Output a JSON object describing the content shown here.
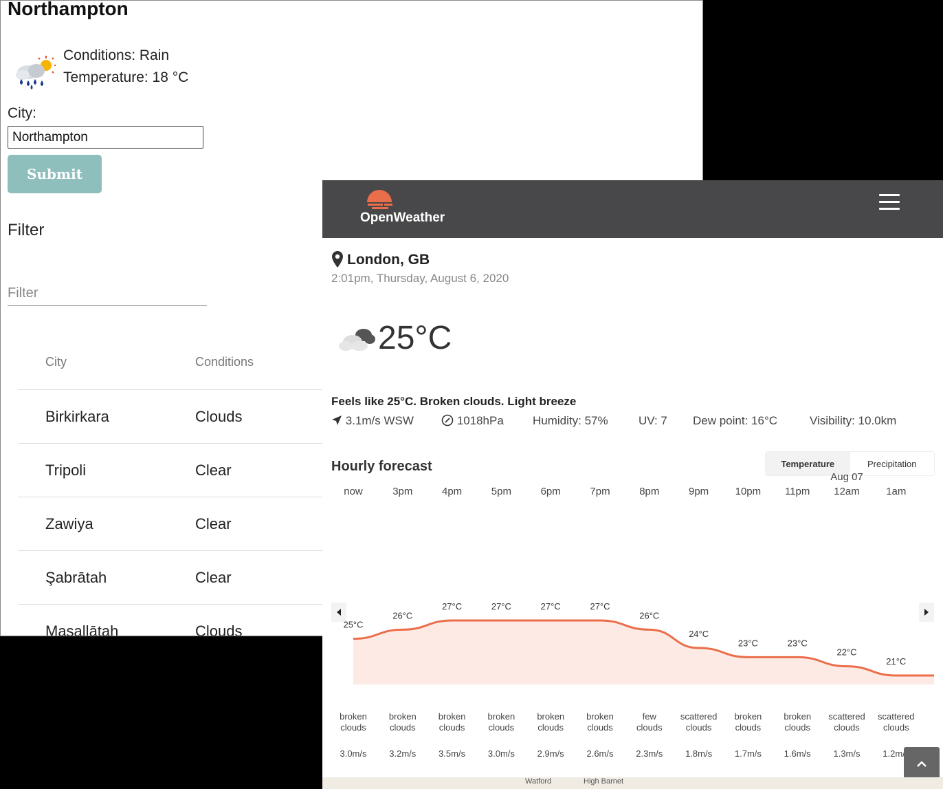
{
  "left_app": {
    "title": "Northampton",
    "current": {
      "conditions": "Conditions: Rain",
      "temperature": "Temperature: 18 °C",
      "icon": "rain-sun-icon"
    },
    "city_label": "City:",
    "city_value": "Northampton",
    "submit_label": "Submit",
    "filter_heading": "Filter",
    "filter_placeholder": "Filter",
    "table": {
      "headers": [
        "City",
        "Conditions"
      ],
      "rows": [
        [
          "Birkirkara",
          "Clouds"
        ],
        [
          "Tripoli",
          "Clear"
        ],
        [
          "Zawiya",
          "Clear"
        ],
        [
          "Şabrātah",
          "Clear"
        ],
        [
          "Masallātah",
          "Clouds"
        ]
      ]
    },
    "colors": {
      "submit_bg": "#8fbfbd"
    }
  },
  "openweather": {
    "brand": "OpenWeather",
    "location": "London, GB",
    "datetime": "2:01pm, Thursday, August 6, 2020",
    "temperature": "25°C",
    "summary": "Feels like 25°C. Broken clouds. Light breeze",
    "stats": {
      "wind": "3.1m/s WSW",
      "pressure": "1018hPa",
      "humidity": "Humidity:  57%",
      "uv": "UV:  7",
      "dew_point": "Dew point:  16°C",
      "visibility": "Visibility:  10.0km"
    },
    "hourly_title": "Hourly forecast",
    "toggle": [
      "Temperature",
      "Precipitation"
    ],
    "hours": [
      {
        "label": "now"
      },
      {
        "label": "3pm"
      },
      {
        "label": "4pm"
      },
      {
        "label": "5pm"
      },
      {
        "label": "6pm"
      },
      {
        "label": "7pm"
      },
      {
        "label": "8pm"
      },
      {
        "label": "9pm"
      },
      {
        "label": "10pm"
      },
      {
        "label": "11pm"
      },
      {
        "label": "12am",
        "date": "Aug 07"
      },
      {
        "label": "1am"
      }
    ],
    "temps": [
      25,
      26,
      27,
      27,
      27,
      27,
      26,
      24,
      23,
      23,
      22,
      21
    ],
    "temp_labels": [
      "25°C",
      "26°C",
      "27°C",
      "27°C",
      "27°C",
      "27°C",
      "26°C",
      "24°C",
      "23°C",
      "23°C",
      "22°C",
      "21°C"
    ],
    "descriptions": [
      "broken\nclouds",
      "broken\nclouds",
      "broken\nclouds",
      "broken\nclouds",
      "broken\nclouds",
      "broken\nclouds",
      "few\nclouds",
      "scattered\nclouds",
      "broken\nclouds",
      "broken\nclouds",
      "scattered\nclouds",
      "scattered\nclouds"
    ],
    "winds": [
      "3.0m/s",
      "3.2m/s",
      "3.5m/s",
      "3.0m/s",
      "2.9m/s",
      "2.6m/s",
      "2.3m/s",
      "1.8m/s",
      "1.7m/s",
      "1.6m/s",
      "1.3m/s",
      "1.2m/s"
    ],
    "map_labels": [
      "Watford",
      "High Barnet"
    ],
    "colors": {
      "navbar": "#48484a",
      "accent": "#eb6e4b",
      "chart_fill": "#fdeae4"
    }
  }
}
